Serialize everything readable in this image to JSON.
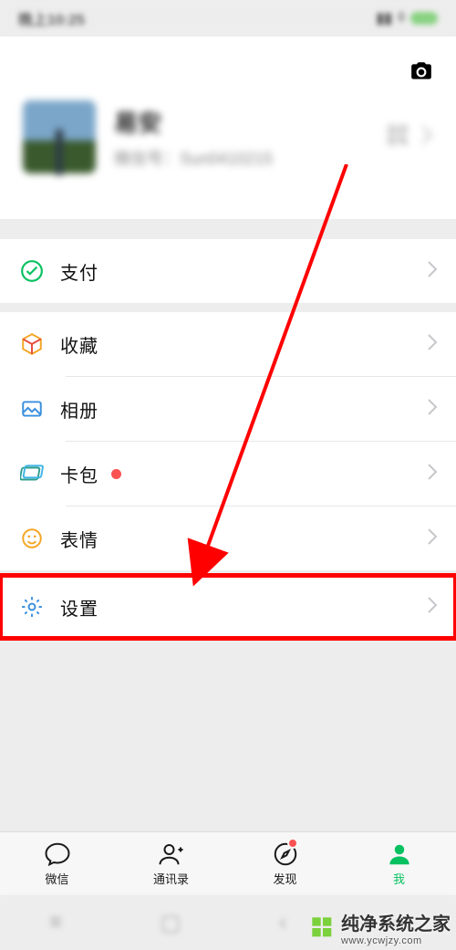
{
  "status": {
    "time": "晚上10:25"
  },
  "profile": {
    "name": "易安",
    "wxid_label": "微信号：",
    "wxid_value": "Sun0410215"
  },
  "menu": {
    "pay": {
      "label": "支付"
    },
    "fav": {
      "label": "收藏"
    },
    "album": {
      "label": "相册"
    },
    "cards": {
      "label": "卡包"
    },
    "stickers": {
      "label": "表情"
    },
    "settings": {
      "label": "设置"
    }
  },
  "tabs": {
    "chat": {
      "label": "微信"
    },
    "contacts": {
      "label": "通讯录"
    },
    "discover": {
      "label": "发现",
      "has_badge": true
    },
    "me": {
      "label": "我",
      "active": true
    }
  },
  "watermark": {
    "title": "纯净系统之家",
    "url": "www.ycwjzy.com"
  },
  "colors": {
    "accent": "#07c160",
    "badge": "#fa5151",
    "annot": "#ff0000"
  }
}
